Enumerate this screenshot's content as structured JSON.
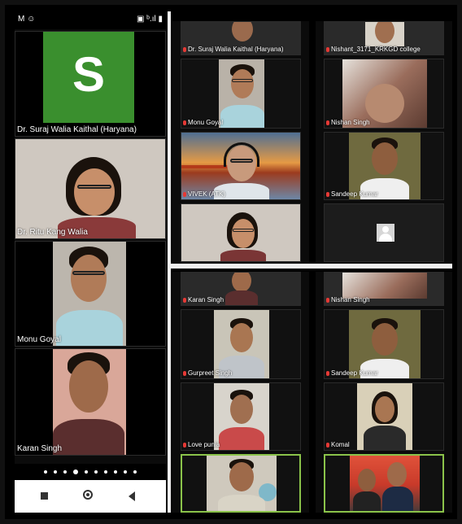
{
  "status_bar": {
    "left": "M ☺",
    "right": "▣ ᵇ.ıl ▮"
  },
  "left_panel": {
    "tiles": [
      {
        "initial": "S",
        "name": "Dr. Suraj Walia Kaithal (Haryana)",
        "bg": "#3a8f2e"
      },
      {
        "name": "Dr. Ritu Kang Walia"
      },
      {
        "name": "Monu Goyal"
      },
      {
        "name": "Karan Singh"
      }
    ],
    "page_dots": 10,
    "active_dot": 3
  },
  "grid1": {
    "tiles": [
      {
        "name": "Dr. Suraj Walia Kaithal (Haryana)"
      },
      {
        "name": "Monu Goyal"
      },
      {
        "name": "VIVEK (ATK)"
      },
      {
        "name": ""
      }
    ]
  },
  "grid2": {
    "tiles": [
      {
        "name": "Nishant_3171_KRKGD college"
      },
      {
        "name": "Nishan Singh"
      },
      {
        "name": "Sandeep Kumar"
      },
      {
        "name": ""
      }
    ]
  },
  "grid3": {
    "tiles": [
      {
        "name": "Karan Singh"
      },
      {
        "name": "Gurpreet Singh"
      },
      {
        "name": "Love punia"
      },
      {
        "name": ""
      }
    ]
  },
  "grid4": {
    "tiles": [
      {
        "name": "Nishan Singh"
      },
      {
        "name": "Sandeep Kumar"
      },
      {
        "name": "Komal"
      },
      {
        "name": ""
      }
    ]
  }
}
